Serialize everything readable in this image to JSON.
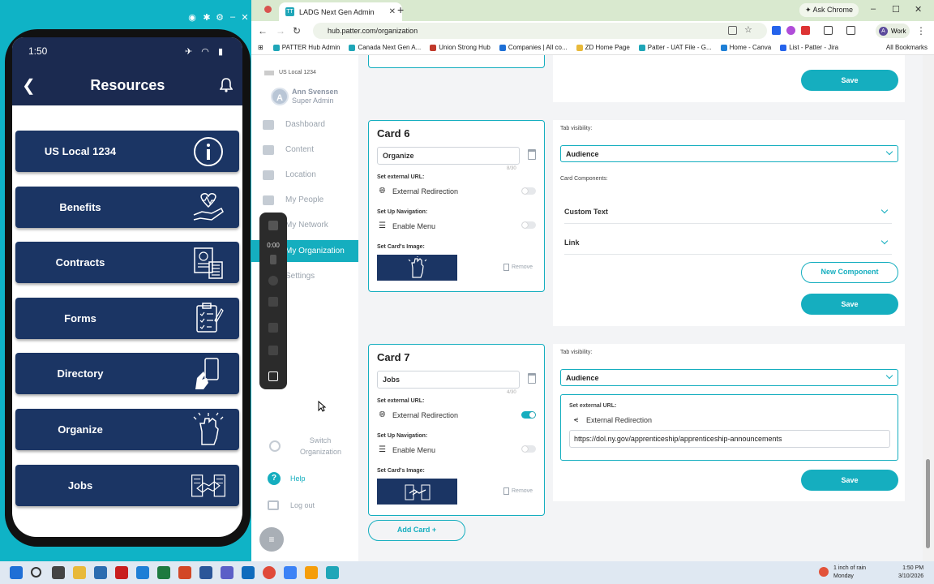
{
  "phone": {
    "time": "1:50",
    "title": "Resources",
    "items": [
      {
        "label": "US Local 1234",
        "icon": "info-circle-icon"
      },
      {
        "label": "Benefits",
        "icon": "heart-hand-icon"
      },
      {
        "label": "Contracts",
        "icon": "document-building-icon"
      },
      {
        "label": "Forms",
        "icon": "clipboard-form-icon"
      },
      {
        "label": "Directory",
        "icon": "phone-hand-icon"
      },
      {
        "label": "Organize",
        "icon": "raised-fist-icon"
      },
      {
        "label": "Jobs",
        "icon": "handshake-icon"
      }
    ]
  },
  "browser": {
    "tab_title": "LADG Next Gen Admin",
    "ask": "Ask Chrome",
    "url": "hub.patter.com/organization",
    "profile": "Work",
    "bookmarks": [
      "PATTER Hub Admin",
      "Canada Next Gen A...",
      "Union Strong Hub",
      "Companies | All co...",
      "ZD Home Page",
      "Patter - UAT File - G...",
      "Home - Canva",
      "List - Patter - Jira"
    ],
    "all_bookmarks": "All Bookmarks"
  },
  "sidebar": {
    "org": "US Local 1234",
    "user_initial": "A",
    "user_name": "Ann Svensen",
    "user_role": "Super Admin",
    "nav": [
      "Dashboard",
      "Content",
      "Location",
      "My People",
      "My Network",
      "My Organization",
      "Settings"
    ],
    "switch": "Switch Organization",
    "help": "Help",
    "logout": "Log out",
    "recorder_time": "0:00"
  },
  "cards": {
    "card6": {
      "title": "Card 6",
      "name": "Organize",
      "count": "8/30",
      "ext_label": "Set external URL:",
      "ext_text": "External Redirection",
      "ext_on": false,
      "nav_label": "Set Up Navigation:",
      "nav_text": "Enable Menu",
      "img_label": "Set Card's Image:",
      "remove": "Remove"
    },
    "card7": {
      "title": "Card 7",
      "name": "Jobs",
      "count": "4/30",
      "ext_label": "Set external URL:",
      "ext_text": "External Redirection",
      "ext_on": true,
      "nav_label": "Set Up Navigation:",
      "nav_text": "Enable Menu",
      "img_label": "Set Card's Image:",
      "remove": "Remove"
    },
    "add_card": "Add Card  +"
  },
  "panels": {
    "save": "Save",
    "tab_visibility": "Tab visibility:",
    "audience": "Audience",
    "card_components": "Card Components:",
    "components": [
      "Custom Text",
      "Link"
    ],
    "new_component": "New Component",
    "set_external": "Set external URL:",
    "external_redirection": "External Redirection",
    "url_value": "https://dol.ny.gov/apprenticeship/apprenticeship-announcements"
  },
  "taskbar": {
    "weather_line1": "1 inch of rain",
    "weather_line2": "Monday",
    "time": "1:50 PM",
    "date": "3/10/2026"
  },
  "colors": {
    "teal": "#15aebf",
    "navy": "#1b3564"
  }
}
